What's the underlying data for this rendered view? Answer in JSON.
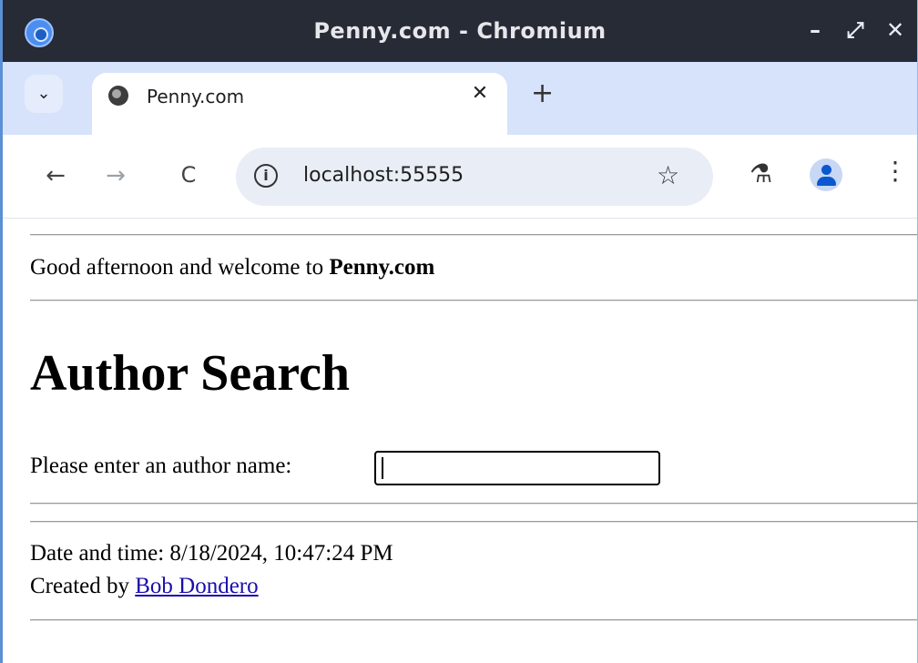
{
  "window": {
    "title": "Penny.com - Chromium",
    "controls": {
      "minimize": "–",
      "maximize": "⤢",
      "close": "✕"
    }
  },
  "tabs": {
    "list_button_icon": "chevron-down-icon",
    "list_button_glyph": "⌄",
    "active_tab": {
      "title": "Penny.com",
      "favicon": "globe-icon",
      "close_glyph": "✕"
    },
    "new_tab_glyph": "+"
  },
  "toolbar": {
    "back_glyph": "←",
    "forward_glyph": "→",
    "reload_glyph": "C",
    "site_info_glyph": "i",
    "url": "localhost:55555",
    "bookmark_glyph": "☆",
    "labs_glyph": "⚗",
    "menu_glyph": "⋮"
  },
  "page": {
    "greeting_prefix": "Good afternoon and welcome to ",
    "greeting_site": "Penny.com",
    "heading": "Author Search",
    "prompt_label": "Please enter an author name:",
    "author_input_value": "",
    "datetime": "Date and time: 8/18/2024, 10:47:24 PM",
    "created_prefix": "Created by ",
    "creator_name": "Bob Dondero"
  },
  "colors": {
    "titlebar": "#272b36",
    "tabstrip": "#d6e3fb",
    "omnibox": "#e9eef6",
    "link": "#1a0dab",
    "profile_accent": "#0b57d0"
  }
}
